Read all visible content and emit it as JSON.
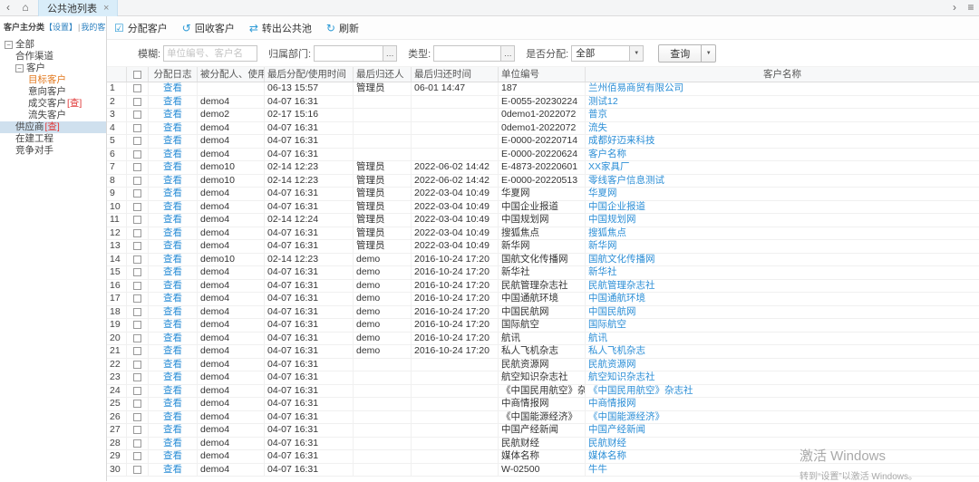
{
  "icons": {
    "back": "‹",
    "forward": "›",
    "menu": "≡",
    "home": "⌂",
    "close": "×",
    "expander": "−",
    "ellipsis": "…",
    "dropdown": "▼"
  },
  "topbar": {
    "tab_label": "公共池列表"
  },
  "sidebar": {
    "header": {
      "title": "客户主分类",
      "settings": "【设置】",
      "separator": "|",
      "view": "我的客户视图"
    },
    "tree": [
      {
        "label": "全部",
        "level": 0,
        "expander": true
      },
      {
        "label": "合作渠道",
        "level": 1
      },
      {
        "label": "客户",
        "level": 1,
        "expander": true
      },
      {
        "label": "目标客户",
        "level": 2,
        "highlight": "orange"
      },
      {
        "label": "意向客户",
        "level": 2
      },
      {
        "label": "成交客户",
        "badge": "[查]",
        "level": 2
      },
      {
        "label": "流失客户",
        "level": 2
      },
      {
        "label": "供应商",
        "badge": "[查]",
        "level": 1,
        "selected": true
      },
      {
        "label": "在建工程",
        "level": 1
      },
      {
        "label": "竞争对手",
        "level": 1
      }
    ]
  },
  "toolbar": {
    "buttons": [
      {
        "label": "分配客户",
        "icon": "☑"
      },
      {
        "label": "回收客户",
        "icon": "↺"
      },
      {
        "label": "转出公共池",
        "icon": "⇄"
      },
      {
        "label": "刷新",
        "icon": "↻"
      }
    ]
  },
  "filters": {
    "fuzzy_label": "模糊:",
    "fuzzy_placeholder": "单位编号、客户名",
    "dept_label": "归属部门:",
    "type_label": "类型:",
    "assigned_label": "是否分配:",
    "assigned_value": "全部",
    "query_label": "查询"
  },
  "table": {
    "headers": {
      "log": "分配日志",
      "assignee": "被分配人、使用人",
      "time": "最后分配/使用时间",
      "returner": "最后归还人",
      "rtime": "最后归还时间",
      "unit": "单位编号",
      "name": "客户名称"
    },
    "rows": [
      {
        "n": "1",
        "log": "查看",
        "assignee": "",
        "time": "06-13 15:57",
        "returner": "管理员",
        "rtime": "06-01 14:47",
        "unit": "187",
        "name": "兰州佰易商贸有限公司"
      },
      {
        "n": "2",
        "log": "查看",
        "assignee": "demo4",
        "time": "04-07 16:31",
        "returner": "",
        "rtime": "",
        "unit": "E-0055-20230224",
        "name": "测试12"
      },
      {
        "n": "3",
        "log": "查看",
        "assignee": "demo2",
        "time": "02-17 15:16",
        "returner": "",
        "rtime": "",
        "unit": "0demo1-2022072",
        "name": "普京"
      },
      {
        "n": "4",
        "log": "查看",
        "assignee": "demo4",
        "time": "04-07 16:31",
        "returner": "",
        "rtime": "",
        "unit": "0demo1-2022072",
        "name": "流失"
      },
      {
        "n": "5",
        "log": "查看",
        "assignee": "demo4",
        "time": "04-07 16:31",
        "returner": "",
        "rtime": "",
        "unit": "E-0000-20220714",
        "name": "成都好迈来科技"
      },
      {
        "n": "6",
        "log": "查看",
        "assignee": "demo4",
        "time": "04-07 16:31",
        "returner": "",
        "rtime": "",
        "unit": "E-0000-20220624",
        "name": "客户名称"
      },
      {
        "n": "7",
        "log": "查看",
        "assignee": "demo10",
        "time": "02-14 12:23",
        "returner": "管理员",
        "rtime": "2022-06-02 14:42",
        "unit": "E-4873-20220601",
        "name": "XX家具厂"
      },
      {
        "n": "8",
        "log": "查看",
        "assignee": "demo10",
        "time": "02-14 12:23",
        "returner": "管理员",
        "rtime": "2022-06-02 14:42",
        "unit": "E-0000-20220513",
        "name": "零线客户信息测试"
      },
      {
        "n": "9",
        "log": "查看",
        "assignee": "demo4",
        "time": "04-07 16:31",
        "returner": "管理员",
        "rtime": "2022-03-04 10:49",
        "unit": "华夏网",
        "name": "华夏网"
      },
      {
        "n": "10",
        "log": "查看",
        "assignee": "demo4",
        "time": "04-07 16:31",
        "returner": "管理员",
        "rtime": "2022-03-04 10:49",
        "unit": "中国企业报道",
        "name": "中国企业报道"
      },
      {
        "n": "11",
        "log": "查看",
        "assignee": "demo4",
        "time": "02-14 12:24",
        "returner": "管理员",
        "rtime": "2022-03-04 10:49",
        "unit": "中国规划网",
        "name": "中国规划网"
      },
      {
        "n": "12",
        "log": "查看",
        "assignee": "demo4",
        "time": "04-07 16:31",
        "returner": "管理员",
        "rtime": "2022-03-04 10:49",
        "unit": "搜狐焦点",
        "name": "搜狐焦点"
      },
      {
        "n": "13",
        "log": "查看",
        "assignee": "demo4",
        "time": "04-07 16:31",
        "returner": "管理员",
        "rtime": "2022-03-04 10:49",
        "unit": "新华网",
        "name": "新华网"
      },
      {
        "n": "14",
        "log": "查看",
        "assignee": "demo10",
        "time": "02-14 12:23",
        "returner": "demo",
        "rtime": "2016-10-24 17:20",
        "unit": "国航文化传播网",
        "name": "国航文化传播网"
      },
      {
        "n": "15",
        "log": "查看",
        "assignee": "demo4",
        "time": "04-07 16:31",
        "returner": "demo",
        "rtime": "2016-10-24 17:20",
        "unit": "新华社",
        "name": "新华社"
      },
      {
        "n": "16",
        "log": "查看",
        "assignee": "demo4",
        "time": "04-07 16:31",
        "returner": "demo",
        "rtime": "2016-10-24 17:20",
        "unit": "民航管理杂志社",
        "name": "民航管理杂志社"
      },
      {
        "n": "17",
        "log": "查看",
        "assignee": "demo4",
        "time": "04-07 16:31",
        "returner": "demo",
        "rtime": "2016-10-24 17:20",
        "unit": "中国通航环境",
        "name": "中国通航环境"
      },
      {
        "n": "18",
        "log": "查看",
        "assignee": "demo4",
        "time": "04-07 16:31",
        "returner": "demo",
        "rtime": "2016-10-24 17:20",
        "unit": "中国民航网",
        "name": "中国民航网"
      },
      {
        "n": "19",
        "log": "查看",
        "assignee": "demo4",
        "time": "04-07 16:31",
        "returner": "demo",
        "rtime": "2016-10-24 17:20",
        "unit": "国际航空",
        "name": "国际航空"
      },
      {
        "n": "20",
        "log": "查看",
        "assignee": "demo4",
        "time": "04-07 16:31",
        "returner": "demo",
        "rtime": "2016-10-24 17:20",
        "unit": "航讯",
        "name": "航讯"
      },
      {
        "n": "21",
        "log": "查看",
        "assignee": "demo4",
        "time": "04-07 16:31",
        "returner": "demo",
        "rtime": "2016-10-24 17:20",
        "unit": "私人飞机杂志",
        "name": "私人飞机杂志"
      },
      {
        "n": "22",
        "log": "查看",
        "assignee": "demo4",
        "time": "04-07 16:31",
        "returner": "",
        "rtime": "",
        "unit": "民航资源网",
        "name": "民航资源网"
      },
      {
        "n": "23",
        "log": "查看",
        "assignee": "demo4",
        "time": "04-07 16:31",
        "returner": "",
        "rtime": "",
        "unit": "航空知识杂志社",
        "name": "航空知识杂志社"
      },
      {
        "n": "24",
        "log": "查看",
        "assignee": "demo4",
        "time": "04-07 16:31",
        "returner": "",
        "rtime": "",
        "unit": "《中国民用航空》杂志社",
        "name": "《中国民用航空》杂志社"
      },
      {
        "n": "25",
        "log": "查看",
        "assignee": "demo4",
        "time": "04-07 16:31",
        "returner": "",
        "rtime": "",
        "unit": "中商情报网",
        "name": "中商情报网"
      },
      {
        "n": "26",
        "log": "查看",
        "assignee": "demo4",
        "time": "04-07 16:31",
        "returner": "",
        "rtime": "",
        "unit": "《中国能源经济》",
        "name": "《中国能源经济》"
      },
      {
        "n": "27",
        "log": "查看",
        "assignee": "demo4",
        "time": "04-07 16:31",
        "returner": "",
        "rtime": "",
        "unit": "中国产经新闻",
        "name": "中国产经新闻"
      },
      {
        "n": "28",
        "log": "查看",
        "assignee": "demo4",
        "time": "04-07 16:31",
        "returner": "",
        "rtime": "",
        "unit": "民航财经",
        "name": "民航财经"
      },
      {
        "n": "29",
        "log": "查看",
        "assignee": "demo4",
        "time": "04-07 16:31",
        "returner": "",
        "rtime": "",
        "unit": "媒体名称",
        "name": "媒体名称"
      },
      {
        "n": "30",
        "log": "查看",
        "assignee": "demo4",
        "time": "04-07 16:31",
        "returner": "",
        "rtime": "",
        "unit": "W-02500",
        "name": "牛牛"
      }
    ]
  },
  "watermark": {
    "line1": "激活 Windows",
    "line2": "转到“设置”以激活 Windows。"
  }
}
